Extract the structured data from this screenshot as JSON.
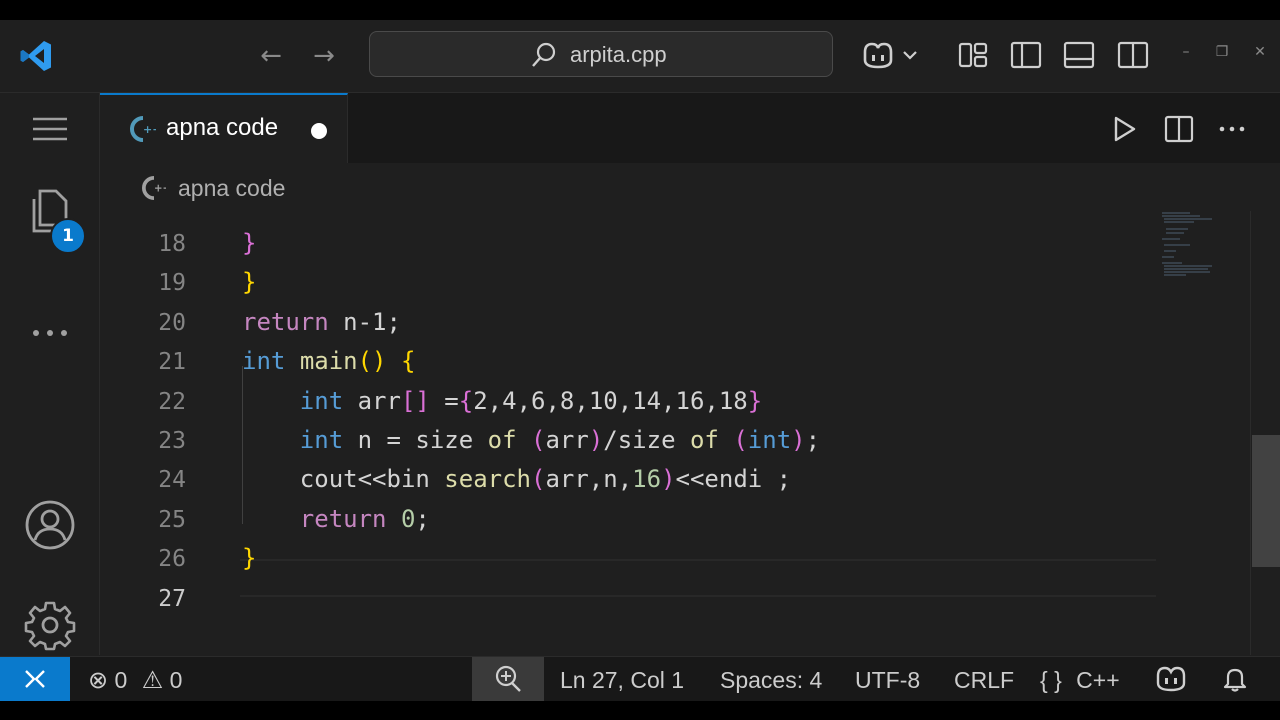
{
  "window": {
    "search_text": "arpita.cpp",
    "accent_color": "#0a7acc"
  },
  "activity_bar": {
    "explorer_badge": "1"
  },
  "tab": {
    "label": "apna code",
    "icon": "cpp-file-icon",
    "modified": true
  },
  "breadcrumb": {
    "label": "apna code"
  },
  "editor": {
    "current_line": "27",
    "line_numbers": [
      "18",
      "19",
      "20",
      "21",
      "22",
      "23",
      "24",
      "25",
      "26",
      "27"
    ],
    "lines": [
      [
        {
          "t": "}",
          "c": "b2"
        }
      ],
      [
        {
          "t": "}",
          "c": "b1"
        }
      ],
      [
        {
          "t": "return",
          "c": "ctl"
        },
        {
          "t": " n-1;",
          "c": ""
        }
      ],
      [
        {
          "t": "int",
          "c": "kw"
        },
        {
          "t": " ",
          "c": ""
        },
        {
          "t": "main",
          "c": "fn"
        },
        {
          "t": "()",
          "c": "b1"
        },
        {
          "t": " ",
          "c": ""
        },
        {
          "t": "{",
          "c": "b1"
        }
      ],
      [
        {
          "t": "    ",
          "c": ""
        },
        {
          "t": "int",
          "c": "kw"
        },
        {
          "t": " arr",
          "c": ""
        },
        {
          "t": "[]",
          "c": "b2"
        },
        {
          "t": " =",
          "c": ""
        },
        {
          "t": "{",
          "c": "b2"
        },
        {
          "t": "2,4,6,8,10,14,16,18",
          "c": ""
        },
        {
          "t": "}",
          "c": "b2"
        }
      ],
      [
        {
          "t": "    ",
          "c": ""
        },
        {
          "t": "int",
          "c": "kw"
        },
        {
          "t": " n = size ",
          "c": ""
        },
        {
          "t": "of",
          "c": "fn"
        },
        {
          "t": " ",
          "c": ""
        },
        {
          "t": "(",
          "c": "b2"
        },
        {
          "t": "arr",
          "c": ""
        },
        {
          "t": ")",
          "c": "b2"
        },
        {
          "t": "/size ",
          "c": ""
        },
        {
          "t": "of",
          "c": "fn"
        },
        {
          "t": " ",
          "c": ""
        },
        {
          "t": "(",
          "c": "b2"
        },
        {
          "t": "int",
          "c": "kw"
        },
        {
          "t": ")",
          "c": "b2"
        },
        {
          "t": ";",
          "c": ""
        }
      ],
      [
        {
          "t": "    cout<<bin ",
          "c": ""
        },
        {
          "t": "search",
          "c": "fn"
        },
        {
          "t": "(",
          "c": "b2"
        },
        {
          "t": "arr,n,",
          "c": ""
        },
        {
          "t": "16",
          "c": "num"
        },
        {
          "t": ")",
          "c": "b2"
        },
        {
          "t": "<<endi ;",
          "c": ""
        }
      ],
      [
        {
          "t": "    ",
          "c": ""
        },
        {
          "t": "return",
          "c": "ctl"
        },
        {
          "t": " ",
          "c": ""
        },
        {
          "t": "0",
          "c": "num"
        },
        {
          "t": ";",
          "c": ""
        }
      ],
      [
        {
          "t": "}",
          "c": "b1"
        }
      ],
      []
    ]
  },
  "status_bar": {
    "errors": "0",
    "warnings": "0",
    "position": "Ln 27, Col 1",
    "spaces": "Spaces: 4",
    "encoding": "UTF-8",
    "eol": "CRLF",
    "language": "C++",
    "language_icon": "{ }"
  }
}
